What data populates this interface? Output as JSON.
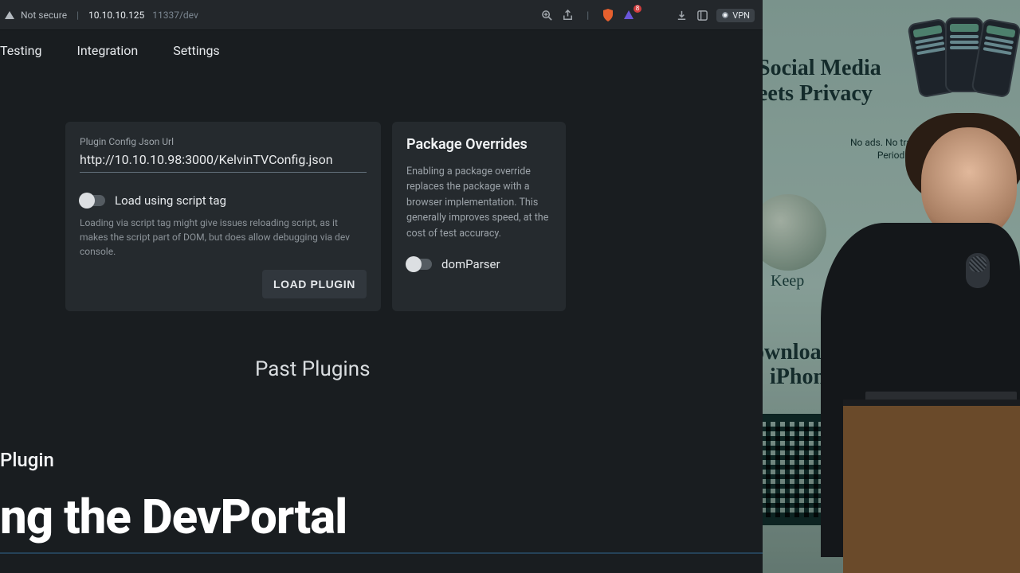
{
  "chrome": {
    "not_secure": "Not secure",
    "host": "10.10.10.125",
    "path": "11337/dev",
    "vpn": "VPN",
    "badge": "8"
  },
  "tabs": {
    "testing": "Testing",
    "integration": "Integration",
    "settings": "Settings"
  },
  "load_card": {
    "field_label": "Plugin Config Json Url",
    "url_value": "http://10.10.10.98:3000/KelvinTVConfig.json",
    "toggle_label": "Load using script tag",
    "toggle_help": "Loading via script tag might give issues reloading script, as it makes the script part of DOM, but does allow debugging via dev console.",
    "button": "LOAD PLUGIN"
  },
  "pkg_card": {
    "title": "Package Overrides",
    "desc": "Enabling a package override replaces the package with a browser implementation. This generally improves speed, at the cost of test accuracy.",
    "toggle_label": "domParser"
  },
  "past_plugins_heading": "Past Plugins",
  "overlay": {
    "eyebrow": "Plugin",
    "headline": "ng the DevPortal"
  },
  "banner": {
    "headline1": "Social Media",
    "headline2": "eets Privacy",
    "micro1": "No ads. No tracking",
    "micro2": "Period.",
    "keep": "Keep",
    "download1": "ownload for",
    "download2": "iPhone"
  }
}
